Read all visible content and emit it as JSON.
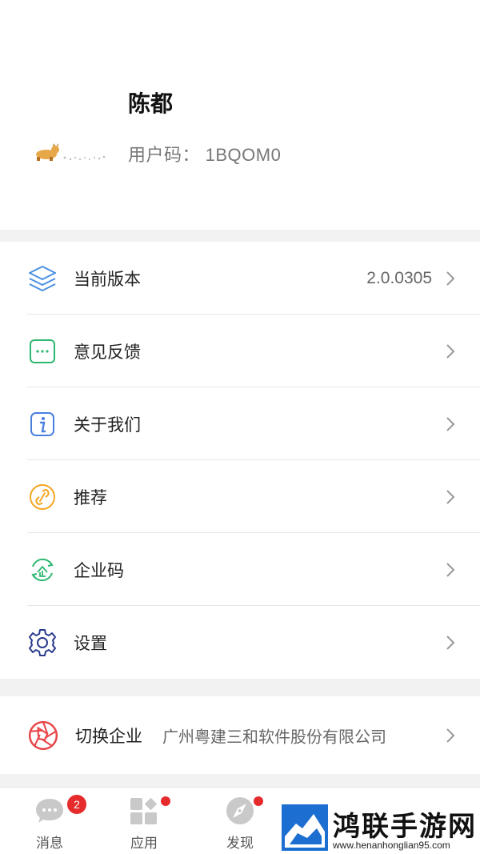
{
  "profile": {
    "name": "陈都",
    "user_code": "用户码： 1BQOM0"
  },
  "menu": [
    {
      "label": "当前版本",
      "value": "2.0.0305",
      "icon": "layers-icon",
      "color": "#4a90e2"
    },
    {
      "label": "意见反馈",
      "value": "",
      "icon": "feedback-chat-icon",
      "color": "#2db86f"
    },
    {
      "label": "关于我们",
      "value": "",
      "icon": "info-icon",
      "color": "#4a7fe0"
    },
    {
      "label": "推荐",
      "value": "",
      "icon": "recommend-link-icon",
      "color": "#f5a623"
    },
    {
      "label": "企业码",
      "value": "",
      "icon": "enterprise-code-icon",
      "color": "#2db86f"
    },
    {
      "label": "设置",
      "value": "",
      "icon": "gear-icon",
      "color": "#2a3a8c"
    }
  ],
  "switch_enterprise": {
    "label": "切换企业",
    "company": "广州粤建三和软件股份有限公司",
    "icon": "aperture-icon",
    "color": "#e8474a"
  },
  "tabbar": {
    "tabs": [
      {
        "label": "消息",
        "badge": "2"
      },
      {
        "label": "应用",
        "badge": ""
      },
      {
        "label": "发现",
        "badge": ""
      }
    ],
    "accent": "#e52b2b"
  },
  "watermark": {
    "title": "鸿联手游网",
    "url": "www.henanhonglian95.com"
  }
}
